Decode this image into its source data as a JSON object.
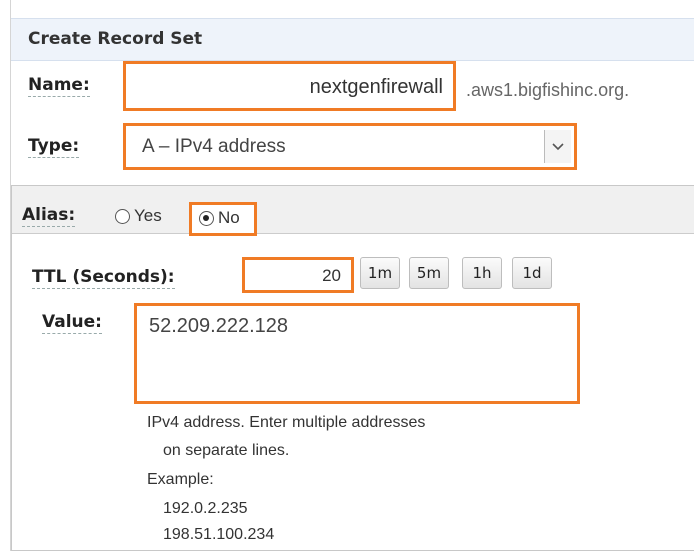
{
  "form": {
    "title": "Create Record Set",
    "name_label": "Name:",
    "name_value": "nextgenfirewall",
    "domain_suffix": ".aws1.bigfishinc.org.",
    "type_label": "Type:",
    "type_value": "A – IPv4 address",
    "alias_label": "Alias:",
    "alias_yes": "Yes",
    "alias_no": "No",
    "alias_selected": "No",
    "ttl_label": "TTL (Seconds):",
    "ttl_value": "20",
    "ttl_buttons": [
      "1m",
      "5m",
      "1h",
      "1d"
    ],
    "value_label": "Value:",
    "value_text": "52.209.222.128",
    "help_lines": [
      "IPv4 address. Enter multiple addresses",
      "on separate lines.",
      "Example:",
      "192.0.2.235",
      "198.51.100.234"
    ]
  },
  "colors": {
    "highlight": "#f07b25",
    "header_bg": "#eef3fa"
  },
  "icons": {
    "dropdown": "chevron-down-icon"
  }
}
